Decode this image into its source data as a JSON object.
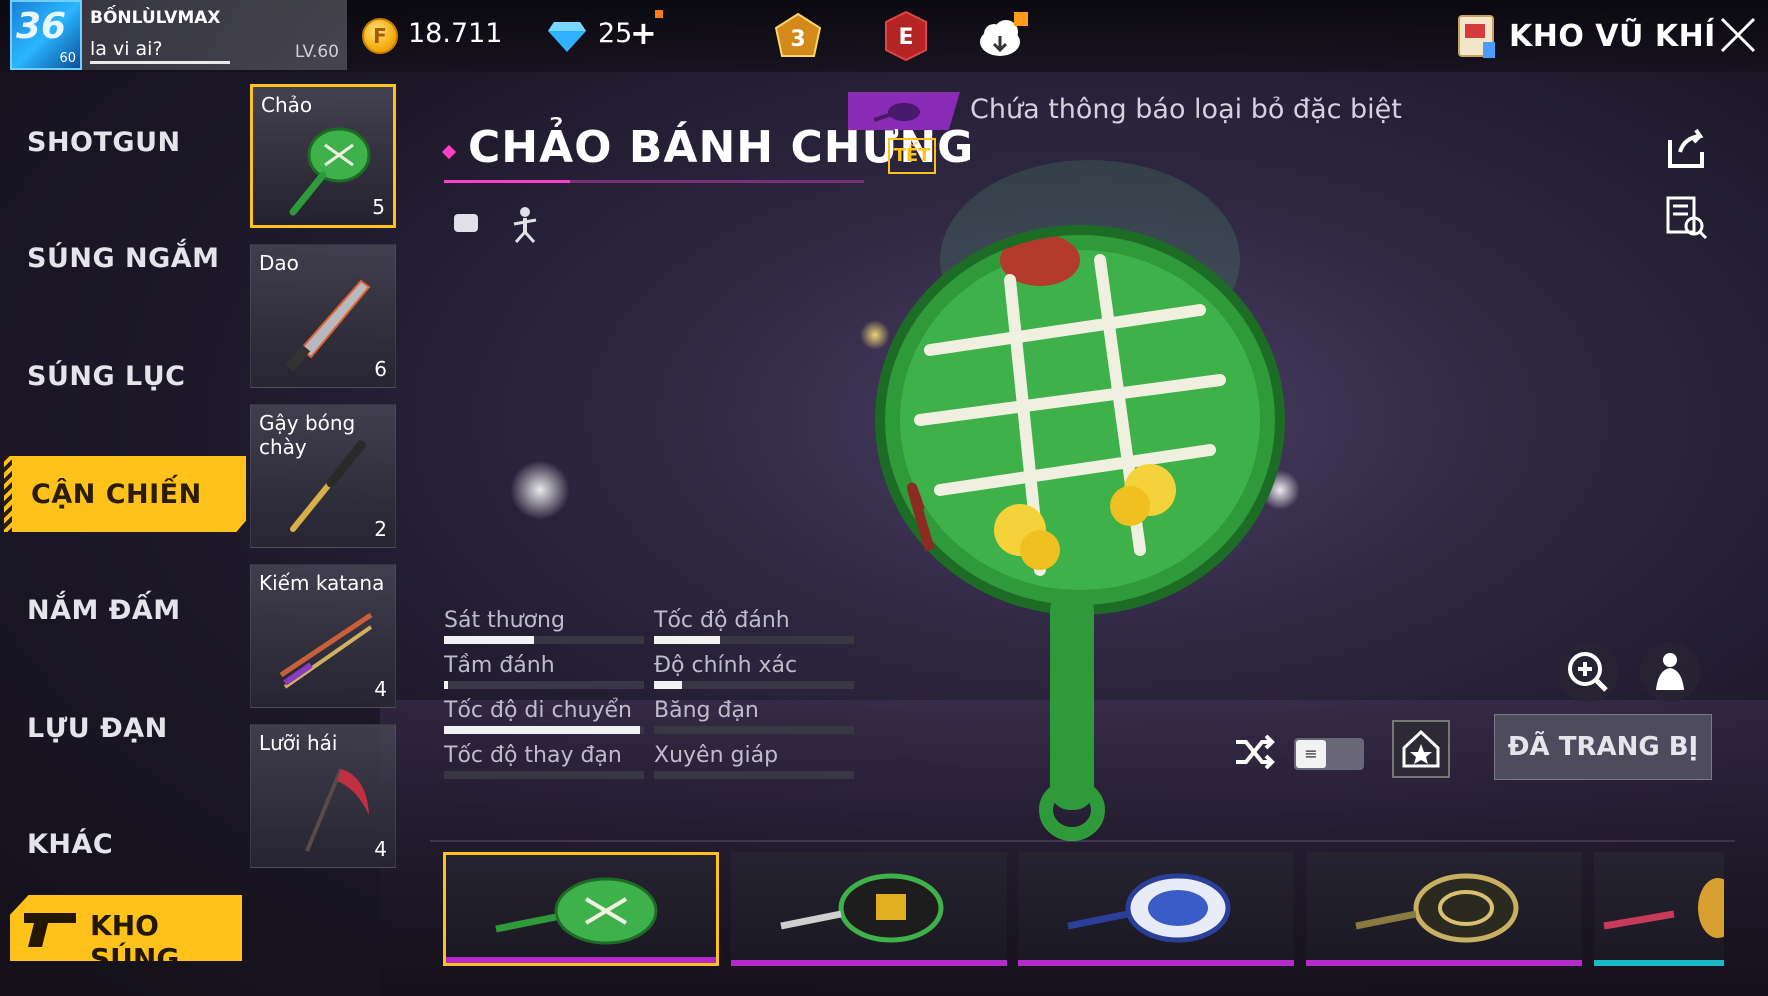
{
  "player": {
    "level_badge": "36",
    "avatar_sub": "60",
    "name": "BỐNLÙLVMAX",
    "signature": "la vi ai?",
    "level": "LV.60"
  },
  "currency": {
    "gold_symbol": "F",
    "gold": "18.711",
    "diamonds": "25",
    "diamonds_plus": "+"
  },
  "top_icons": {
    "rank_badge": "3",
    "elite_badge": "E"
  },
  "header": {
    "title": "KHO VŨ KHÍ"
  },
  "categories": [
    {
      "label": "SHOTGUN"
    },
    {
      "label": "SÚNG NGẮM"
    },
    {
      "label": "SÚNG LỤC"
    },
    {
      "label": "CẬN CHIẾN",
      "active": true
    },
    {
      "label": "NẮM ĐẤM"
    },
    {
      "label": "LỰU ĐẠN"
    },
    {
      "label": "KHÁC"
    }
  ],
  "kho_sung": "KHO SÚNG",
  "weapons": [
    {
      "name": "Chảo",
      "count": "5",
      "selected": true
    },
    {
      "name": "Dao",
      "count": "6"
    },
    {
      "name": "Gậy bóng chày",
      "count": "2"
    },
    {
      "name": "Kiếm katana",
      "count": "4"
    },
    {
      "name": "Lưỡi hái",
      "count": "4"
    }
  ],
  "detail": {
    "notice": "Chứa thông báo loại bỏ đặc biệt",
    "title": "CHẢO BÁNH CHƯNG",
    "tag": "TẾT",
    "equip_label": "ĐÃ TRANG BỊ",
    "toggle_icon": "≡"
  },
  "stats": [
    {
      "label": "Sát thương",
      "value": 0.45
    },
    {
      "label": "Tốc độ đánh",
      "value": 0.33
    },
    {
      "label": "Tầm đánh",
      "value": 0.02
    },
    {
      "label": "Độ chính xác",
      "value": 0.14
    },
    {
      "label": "Tốc độ di chuyển",
      "value": 0.98
    },
    {
      "label": "Băng đạn",
      "value": 0
    },
    {
      "label": "Tốc độ thay đạn",
      "value": 0
    },
    {
      "label": "Xuyên giáp",
      "value": 0
    }
  ],
  "skins": [
    {
      "name": "banh-chung-pan",
      "selected": true
    },
    {
      "name": "green-gold-pan"
    },
    {
      "name": "blue-dragon-pan"
    },
    {
      "name": "gold-pan"
    },
    {
      "name": "teal-pan"
    }
  ],
  "colors": {
    "accent": "#ffc21a",
    "magenta": "#ff3ec7",
    "purple": "#8a2bb5"
  },
  "icons": [
    "search-plus-icon",
    "character-icon",
    "share-icon",
    "details-icon",
    "shuffle-icon",
    "home-icon",
    "close-icon",
    "coin-icon",
    "diamond-icon",
    "gun-icon"
  ]
}
